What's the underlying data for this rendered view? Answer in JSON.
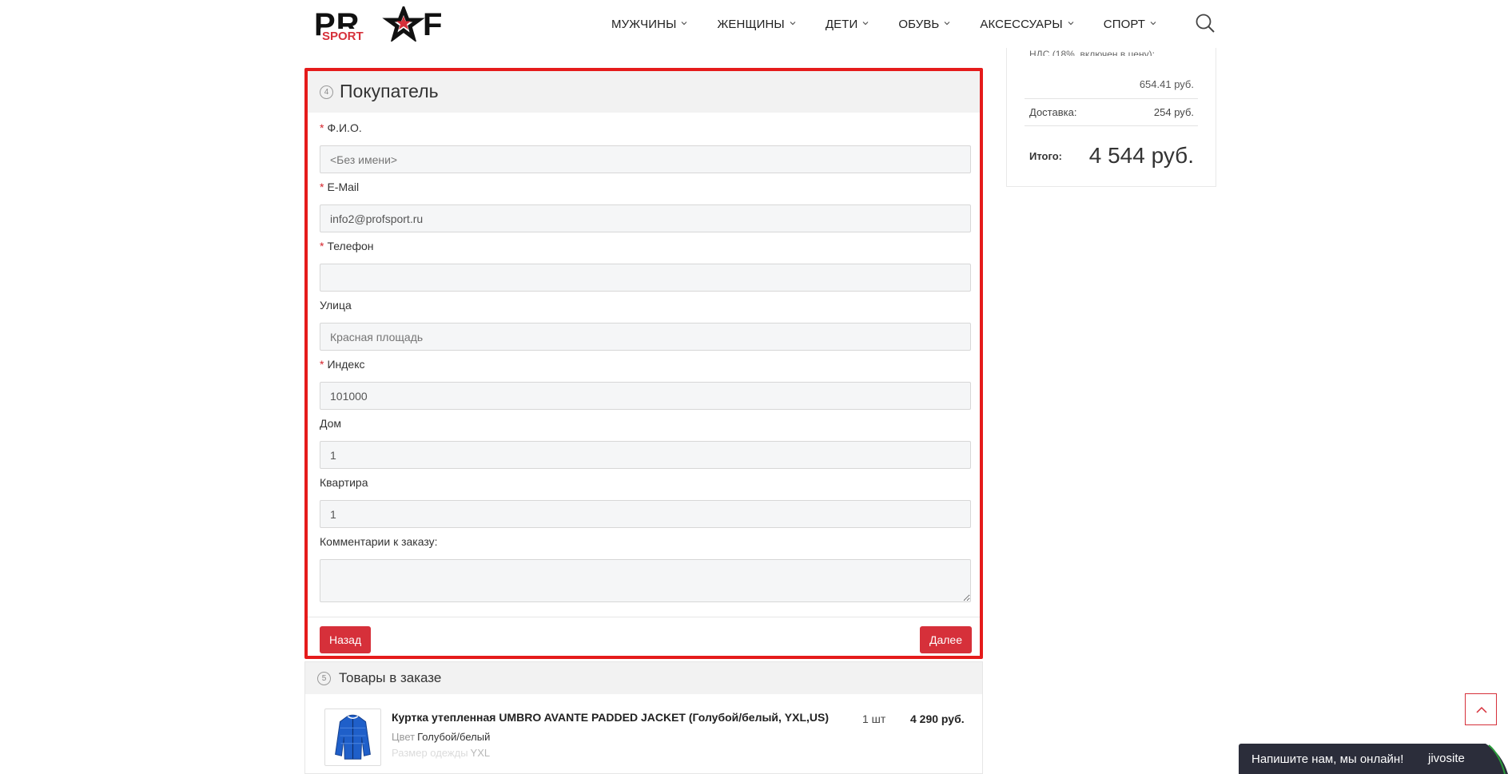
{
  "header": {
    "logo_text": "PROF",
    "logo_sub": "SPORT",
    "nav": [
      {
        "label": "МУЖЧИНЫ"
      },
      {
        "label": "ЖЕНЩИНЫ"
      },
      {
        "label": "ДЕТИ"
      },
      {
        "label": "ОБУВЬ"
      },
      {
        "label": "АКСЕССУАРЫ"
      },
      {
        "label": "СПОРТ"
      }
    ],
    "search_icon": "search-icon"
  },
  "summary": {
    "cut_label": "НДС (18%, включен в цену):",
    "nds_value": "654.41 руб.",
    "delivery_label": "Доставка:",
    "delivery_value": "254 руб.",
    "total_label": "Итого:",
    "total_value": "4 544 руб."
  },
  "buyer": {
    "step": "4",
    "title": "Покупатель",
    "fields": [
      {
        "label": "Ф.И.О.",
        "required": "*",
        "value": "",
        "placeholder": "<Без имени>"
      },
      {
        "label": "E-Mail",
        "required": "*",
        "value": "info2@profsport.ru",
        "placeholder": ""
      },
      {
        "label": "Телефон",
        "required": "*",
        "value": "",
        "placeholder": ""
      },
      {
        "label": "Улица",
        "required": "",
        "value": "",
        "placeholder": "Красная площадь"
      },
      {
        "label": "Индекс",
        "required": "*",
        "value": "101000",
        "placeholder": ""
      },
      {
        "label": "Дом",
        "required": "",
        "value": "1",
        "placeholder": ""
      },
      {
        "label": "Квартира",
        "required": "",
        "value": "1",
        "placeholder": ""
      },
      {
        "label": "Комментарии к заказу:",
        "required": "",
        "value": "",
        "placeholder": ""
      }
    ],
    "back_label": "Назад",
    "next_label": "Далее"
  },
  "goods": {
    "step": "5",
    "title": "Товары в заказе",
    "item": {
      "name": "Куртка утепленная UMBRO AVANTE PADDED JACKET (Голубой/белый, YXL,US)",
      "qty": "1 шт",
      "price": "4 290 руб.",
      "props": [
        {
          "key": "Цвет",
          "value": "Голубой/белый"
        },
        {
          "key": "Размер одежды",
          "value": "YXL"
        }
      ]
    }
  },
  "chat": {
    "text": "Напишите нам, мы онлайн!",
    "brand": "jivosite"
  },
  "colors": {
    "accent_red": "#d6303a",
    "highlight_border": "#e51b1b",
    "chat_bg": "#2b2d3a"
  }
}
